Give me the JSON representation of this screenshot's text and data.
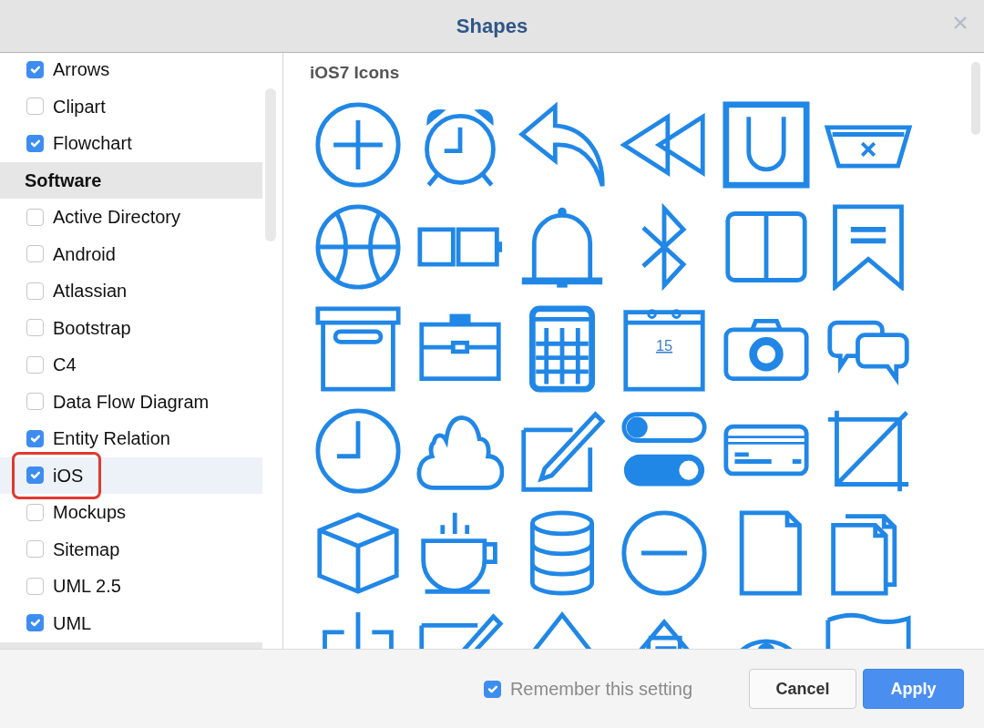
{
  "window": {
    "title": "Shapes"
  },
  "sidebar": {
    "items": [
      {
        "kind": "option",
        "label": "Arrows",
        "checked": true,
        "selected": false,
        "annotated": false
      },
      {
        "kind": "option",
        "label": "Clipart",
        "checked": false,
        "selected": false,
        "annotated": false
      },
      {
        "kind": "option",
        "label": "Flowchart",
        "checked": true,
        "selected": false,
        "annotated": false
      },
      {
        "kind": "header",
        "label": "Software"
      },
      {
        "kind": "option",
        "label": "Active Directory",
        "checked": false,
        "selected": false,
        "annotated": false
      },
      {
        "kind": "option",
        "label": "Android",
        "checked": false,
        "selected": false,
        "annotated": false
      },
      {
        "kind": "option",
        "label": "Atlassian",
        "checked": false,
        "selected": false,
        "annotated": false
      },
      {
        "kind": "option",
        "label": "Bootstrap",
        "checked": false,
        "selected": false,
        "annotated": false
      },
      {
        "kind": "option",
        "label": "C4",
        "checked": false,
        "selected": false,
        "annotated": false
      },
      {
        "kind": "option",
        "label": "Data Flow Diagram",
        "checked": false,
        "selected": false,
        "annotated": false
      },
      {
        "kind": "option",
        "label": "Entity Relation",
        "checked": true,
        "selected": false,
        "annotated": false
      },
      {
        "kind": "option",
        "label": "iOS",
        "checked": true,
        "selected": true,
        "annotated": true
      },
      {
        "kind": "option",
        "label": "Mockups",
        "checked": false,
        "selected": false,
        "annotated": false
      },
      {
        "kind": "option",
        "label": "Sitemap",
        "checked": false,
        "selected": false,
        "annotated": false
      },
      {
        "kind": "option",
        "label": "UML 2.5",
        "checked": false,
        "selected": false,
        "annotated": false
      },
      {
        "kind": "option",
        "label": "UML",
        "checked": true,
        "selected": false,
        "annotated": false
      },
      {
        "kind": "header"
      }
    ]
  },
  "palette": {
    "title": "iOS7 Icons",
    "calendar_day": "15"
  },
  "footer": {
    "remember": {
      "label": "Remember this setting",
      "checked": true
    },
    "buttons": [
      {
        "label": "Cancel",
        "kind": "secondary"
      },
      {
        "label": "Apply",
        "kind": "primary"
      }
    ]
  }
}
